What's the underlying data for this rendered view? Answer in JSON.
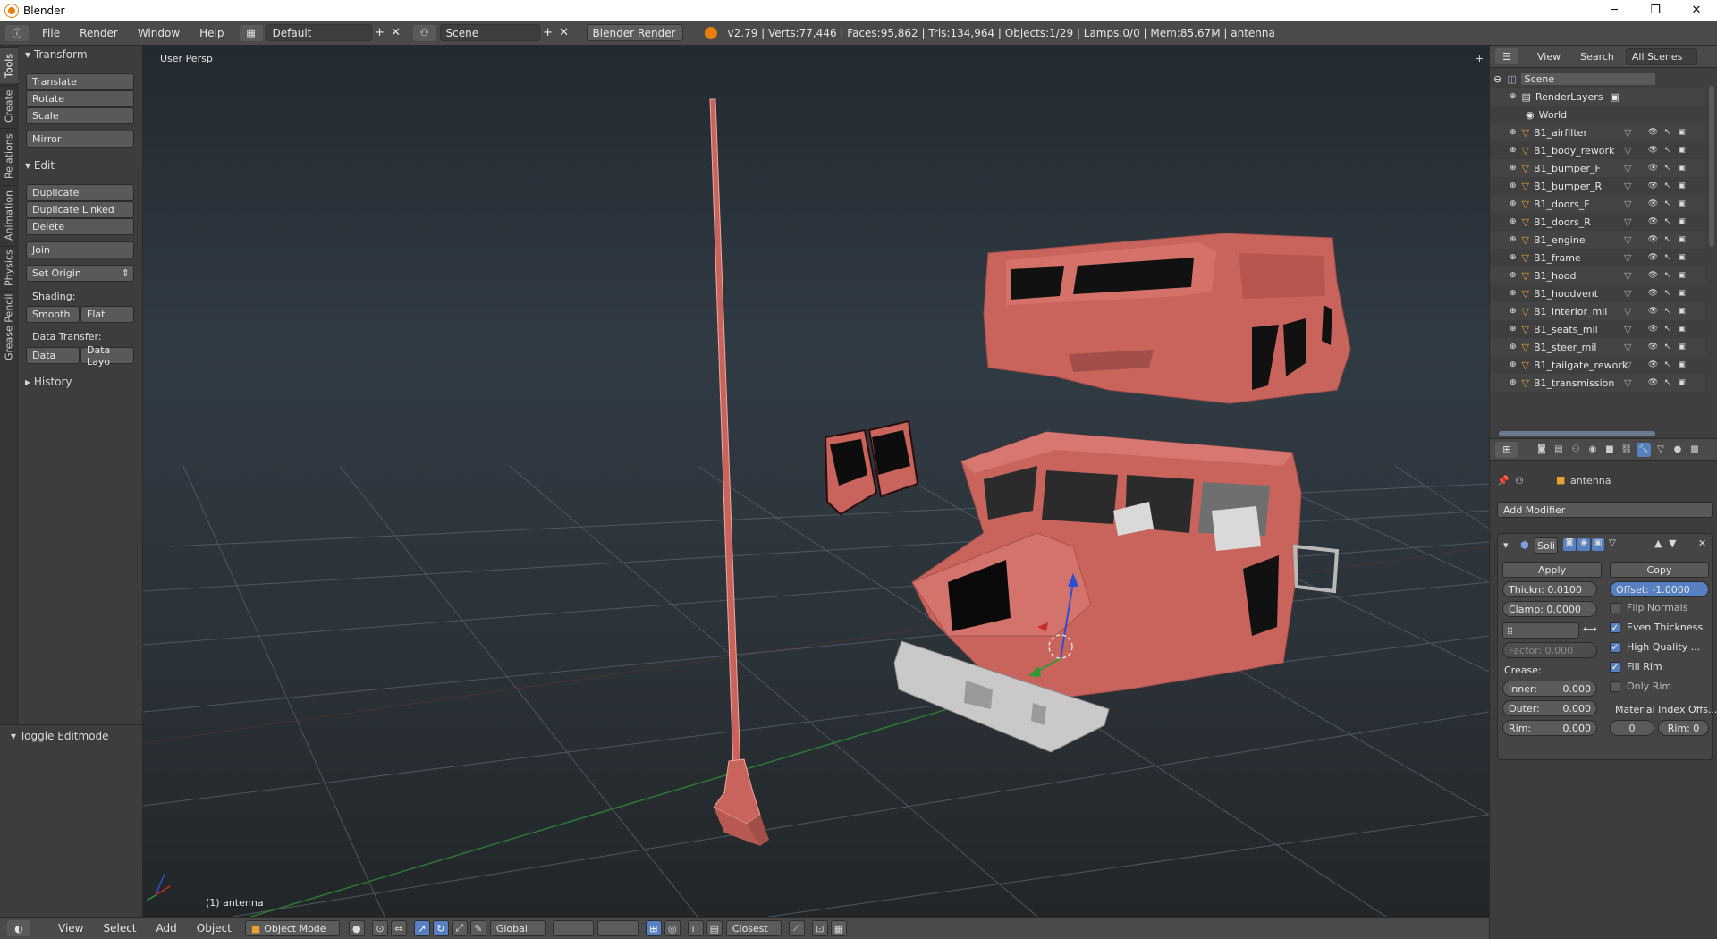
{
  "window": {
    "title": "Blender",
    "minimize": "─",
    "maximize": "❐",
    "close": "✕"
  },
  "info_header": {
    "menus": [
      "File",
      "Render",
      "Window",
      "Help"
    ],
    "layout": "Default",
    "scene": "Scene",
    "engine": "Blender Render",
    "stats": "v2.79 | Verts:77,446 | Faces:95,862 | Tris:134,964 | Objects:1/29 | Lamps:0/0 | Mem:85.67M | antenna"
  },
  "tool_tabs": [
    "Tools",
    "Create",
    "Relations",
    "Animation",
    "Physics",
    "Grease Pencil"
  ],
  "tool_shelf": {
    "transform_header": "Transform",
    "translate": "Translate",
    "rotate": "Rotate",
    "scale": "Scale",
    "mirror": "Mirror",
    "edit_header": "Edit",
    "duplicate": "Duplicate",
    "duplicate_linked": "Duplicate Linked",
    "delete": "Delete",
    "join": "Join",
    "set_origin": "Set Origin",
    "shading_label": "Shading:",
    "smooth": "Smooth",
    "flat": "Flat",
    "data_transfer_label": "Data Transfer:",
    "data": "Data",
    "data_layout": "Data Layo",
    "history_header": "History",
    "toggle_editmode": "Toggle Editmode"
  },
  "viewport": {
    "view_label": "User Persp",
    "object_label": "(1) antenna"
  },
  "bottom_header": {
    "view": "View",
    "select": "Select",
    "add": "Add",
    "object": "Object",
    "mode": "Object Mode",
    "orientation": "Global",
    "snap": "Closest"
  },
  "outliner": {
    "view": "View",
    "search": "Search",
    "filter": "All Scenes",
    "scene": "Scene",
    "render_layers": "RenderLayers",
    "world": "World",
    "objects": [
      "B1_airfilter",
      "B1_body_rework",
      "B1_bumper_F",
      "B1_bumper_R",
      "B1_doors_F",
      "B1_doors_R",
      "B1_engine",
      "B1_frame",
      "B1_hood",
      "B1_hoodvent",
      "B1_interior_mil",
      "B1_seats_mil",
      "B1_steer_mil",
      "B1_tailgate_rework",
      "B1_transmission"
    ]
  },
  "properties": {
    "object_name": "antenna",
    "add_modifier": "Add Modifier",
    "modifier_name": "Soli",
    "apply": "Apply",
    "copy": "Copy",
    "thickness": "Thickn: 0.0100",
    "offset": "Offset: -1.0000",
    "clamp": "Clamp: 0.0000",
    "factor": "Factor: 0.000",
    "crease_label": "Crease:",
    "inner_label": "Inner:",
    "inner_value": "0.000",
    "outer_label": "Outer:",
    "outer_value": "0.000",
    "rim_label": "Rim:",
    "rim_value": "0.000",
    "flip_normals": "Flip Normals",
    "even_thickness": "Even Thickness",
    "high_quality": "High Quality ...",
    "fill_rim": "Fill Rim",
    "only_rim": "Only Rim",
    "material_index": "Material Index Offs...",
    "mat_index_value": "0",
    "mat_rim": "Rim: 0",
    "checks": {
      "flip_normals": false,
      "even_thickness": true,
      "high_quality": true,
      "fill_rim": true,
      "only_rim": false
    }
  },
  "colors": {
    "accent": "#5680c2",
    "model": "#c8645c",
    "bumper": "#c9c9c9",
    "blender_orange": "#e87d0d"
  }
}
